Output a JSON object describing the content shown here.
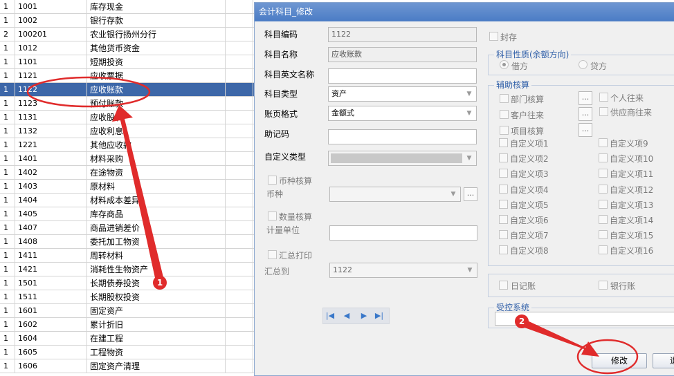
{
  "table": {
    "rows": [
      {
        "level": "1",
        "code": "1001",
        "name": "库存现金"
      },
      {
        "level": "1",
        "code": "1002",
        "name": "银行存款"
      },
      {
        "level": "2",
        "code": "100201",
        "name": "  农业银行扬州分行"
      },
      {
        "level": "1",
        "code": "1012",
        "name": "其他货币资金"
      },
      {
        "level": "1",
        "code": "1101",
        "name": "短期投资"
      },
      {
        "level": "1",
        "code": "1121",
        "name": "应收票据"
      },
      {
        "level": "1",
        "code": "1122",
        "name": "应收账款",
        "selected": true
      },
      {
        "level": "1",
        "code": "1123",
        "name": "预付账款"
      },
      {
        "level": "1",
        "code": "1131",
        "name": "应收股利"
      },
      {
        "level": "1",
        "code": "1132",
        "name": "应收利息"
      },
      {
        "level": "1",
        "code": "1221",
        "name": "其他应收款"
      },
      {
        "level": "1",
        "code": "1401",
        "name": "材料采购"
      },
      {
        "level": "1",
        "code": "1402",
        "name": "在途物资"
      },
      {
        "level": "1",
        "code": "1403",
        "name": "原材料"
      },
      {
        "level": "1",
        "code": "1404",
        "name": "材料成本差异"
      },
      {
        "level": "1",
        "code": "1405",
        "name": "库存商品"
      },
      {
        "level": "1",
        "code": "1407",
        "name": "商品进销差价"
      },
      {
        "level": "1",
        "code": "1408",
        "name": "委托加工物资"
      },
      {
        "level": "1",
        "code": "1411",
        "name": "周转材料"
      },
      {
        "level": "1",
        "code": "1421",
        "name": "消耗性生物资产"
      },
      {
        "level": "1",
        "code": "1501",
        "name": "长期债券投资"
      },
      {
        "level": "1",
        "code": "1511",
        "name": "长期股权投资"
      },
      {
        "level": "1",
        "code": "1601",
        "name": "固定资产"
      },
      {
        "level": "1",
        "code": "1602",
        "name": "累计折旧"
      },
      {
        "level": "1",
        "code": "1604",
        "name": "在建工程"
      },
      {
        "level": "1",
        "code": "1605",
        "name": "工程物资"
      },
      {
        "level": "1",
        "code": "1606",
        "name": "固定资产清理"
      }
    ]
  },
  "dialog": {
    "title": "会计科目_修改",
    "fields": {
      "code_label": "科目编码",
      "code_value": "1122",
      "name_label": "科目名称",
      "name_value": "应收账款",
      "en_name_label": "科目英文名称",
      "en_name_value": "",
      "type_label": "科目类型",
      "type_value": "资产",
      "ledger_label": "账页格式",
      "ledger_value": "金额式",
      "mnemonic_label": "助记码",
      "mnemonic_value": "",
      "custom_type_label": "自定义类型",
      "currency_check_label": "币种核算",
      "currency_label": "币种",
      "qty_check_label": "数量核算",
      "unit_label": "计量单位",
      "summary_print_label": "汇总打印",
      "summary_to_label": "汇总到",
      "summary_to_value": "1122",
      "seal_label": "封存"
    },
    "nature": {
      "title": "科目性质(余额方向)",
      "debit": "借方",
      "credit": "贷方",
      "selected": "借方"
    },
    "aux": {
      "title": "辅助核算",
      "left": [
        "部门核算",
        "客户往来",
        "项目核算"
      ],
      "right": [
        "个人往来",
        "供应商往来"
      ],
      "custom_left": [
        "自定义项1",
        "自定义项2",
        "自定义项3",
        "自定义项4",
        "自定义项5",
        "自定义项6",
        "自定义项7",
        "自定义项8"
      ],
      "custom_right": [
        "自定义项9",
        "自定义项10",
        "自定义项11",
        "自定义项12",
        "自定义项13",
        "自定义项14",
        "自定义项15",
        "自定义项16"
      ]
    },
    "journal_label": "日记账",
    "bank_label": "银行账",
    "control": {
      "title": "受控系统",
      "value": ""
    },
    "buttons": {
      "modify": "修改",
      "exit": "退"
    },
    "ellipsis": "..."
  },
  "annotations": {
    "badge1": "1",
    "badge2": "2",
    "color": "#e02b2b"
  }
}
